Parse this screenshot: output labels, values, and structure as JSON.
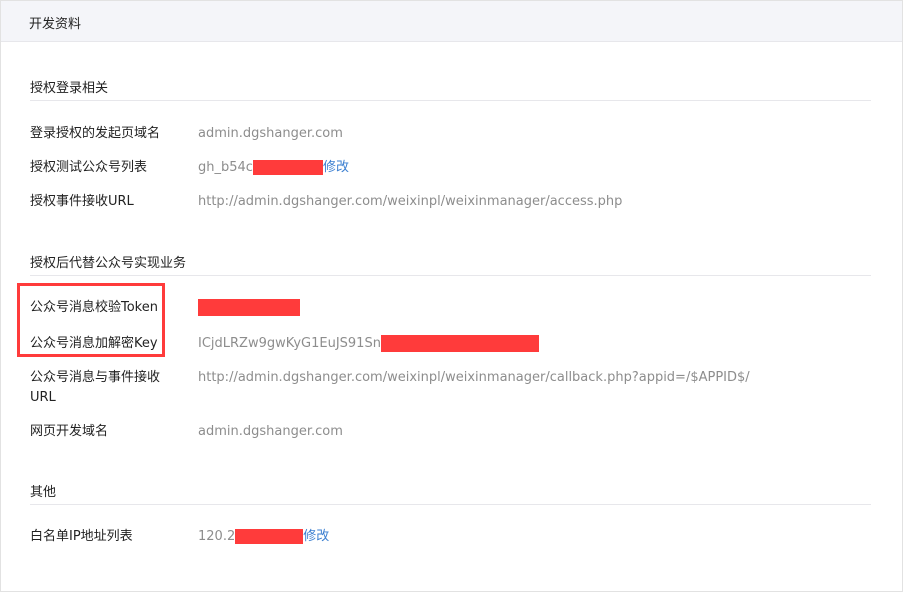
{
  "header": {
    "title": "开发资料"
  },
  "sections": {
    "auth_login": {
      "title": "授权登录相关"
    },
    "auth_business": {
      "title": "授权后代替公众号实现业务"
    },
    "other": {
      "title": "其他"
    }
  },
  "rows": {
    "login_domain": {
      "label": "登录授权的发起页域名",
      "value": "admin.dgshanger.com"
    },
    "test_accounts": {
      "label": "授权测试公众号列表",
      "value_prefix": "gh_b54c",
      "edit_label": "修改"
    },
    "event_url": {
      "label": "授权事件接收URL",
      "value": "http://admin.dgshanger.com/weixinpl/weixinmanager/access.php"
    },
    "msg_token": {
      "label": "公众号消息校验Token"
    },
    "msg_key": {
      "label": "公众号消息加解密Key",
      "value_prefix": "ICjdLRZw9gwKyG1EuJS91Sn"
    },
    "msg_url": {
      "label": "公众号消息与事件接收URL",
      "value": "http://admin.dgshanger.com/weixinpl/weixinmanager/callback.php?appid=/$APPID$/"
    },
    "web_domain": {
      "label": "网页开发域名",
      "value": "admin.dgshanger.com"
    },
    "ip_whitelist": {
      "label": "白名单IP地址列表",
      "value_prefix": "120.2",
      "edit_label": "修改"
    }
  },
  "colors": {
    "redaction": "#ff3b3b",
    "link": "#3b7fd1",
    "header_bg": "#f4f5f9"
  }
}
